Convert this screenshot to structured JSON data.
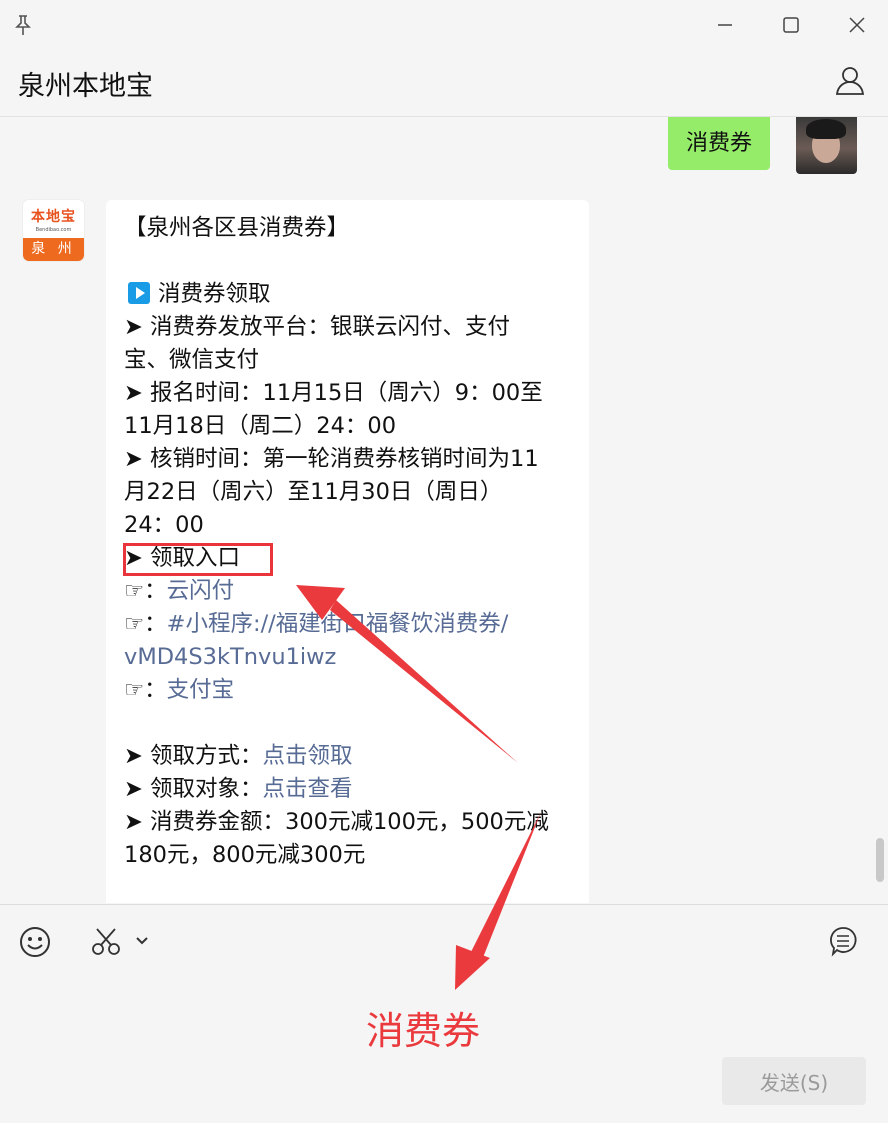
{
  "window": {
    "pin_icon": "pin-icon",
    "minimize_icon": "minimize-icon",
    "maximize_icon": "maximize-icon",
    "close_icon": "close-icon"
  },
  "header": {
    "title": "泉州本地宝",
    "profile_icon": "user-icon"
  },
  "messages": {
    "sent": {
      "text": "消费券"
    },
    "bot_avatar": {
      "brand": "本地宝",
      "url": "Bendibao.com",
      "city": "泉 州"
    },
    "received": {
      "lines": {
        "l1": "【泉州各区县消费券】",
        "l2_label": "消费券领取",
        "l3": "➤ 消费券发放平台：银联云闪付、支付",
        "l4": "宝、微信支付",
        "l5": "➤ 报名时间：11月15日（周六）9：00至",
        "l6": "11月18日（周二）24：00",
        "l7": "➤ 核销时间：第一轮消费券核销时间为11",
        "l8": "月22日（周六）至11月30日（周日）",
        "l9": "24：00",
        "l10": "➤ 领取入口",
        "l11_prefix": "☞：",
        "l11_link": "云闪付",
        "l12_prefix": "☞：",
        "l12_link": "#小程序://福建街口福餐饮消费券/",
        "l13_link": "vMD4S3kTnvu1iwz",
        "l14_prefix": "☞：",
        "l14_link": "支付宝",
        "l15_prefix": "➤ 领取方式：",
        "l15_link": "点击领取",
        "l16_prefix": "➤ 领取对象：",
        "l16_link": "点击查看",
        "l17": "➤ 消费券金额：300元减100元，500元减",
        "l18": "180元，800元减300元"
      }
    }
  },
  "toolbar": {
    "emoji_icon": "emoji-icon",
    "scissors_icon": "scissors-icon",
    "chat_history_icon": "chat-history-icon"
  },
  "input": {
    "send_label": "发送(S)"
  },
  "annotation": {
    "label": "消费券"
  },
  "colors": {
    "sent_bubble": "#95ec69",
    "link": "#576b95",
    "annotation": "#ea3a3e",
    "play_icon": "#1a9be6"
  }
}
